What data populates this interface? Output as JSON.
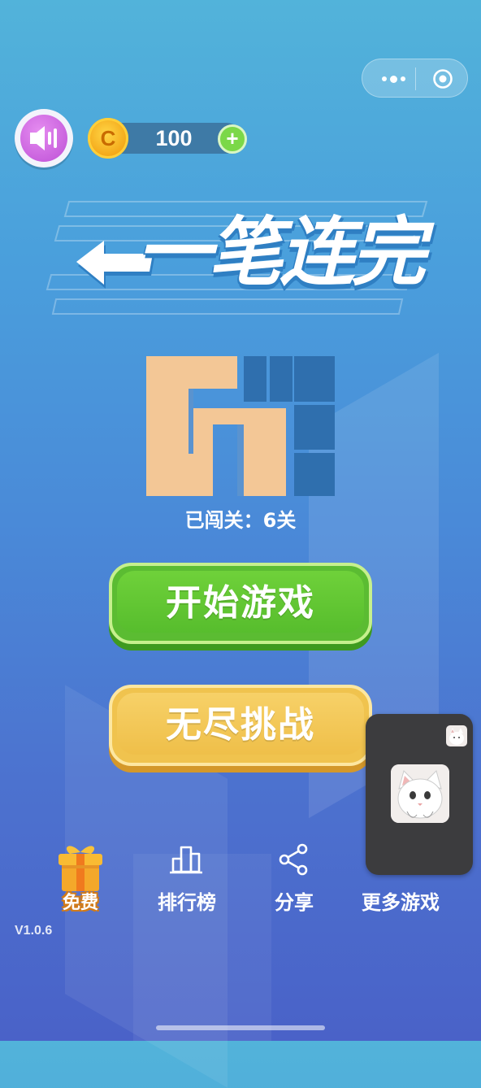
{
  "header": {
    "coins": "100",
    "coin_symbol": "C",
    "coin_plus": "+"
  },
  "logo": {
    "title": "一笔连完"
  },
  "preview": {
    "level_text": "已闯关：6关"
  },
  "buttons": {
    "start": "开始游戏",
    "endless": "无尽挑战"
  },
  "nav": {
    "free": "免费",
    "leaderboard": "排行榜",
    "share": "分享",
    "more_games": "更多游戏"
  },
  "version": "V1.0.6",
  "colors": {
    "start_button": "#5bbc32",
    "endless_button": "#f0c34e",
    "path_fill": "#f3c796",
    "grid_dark": "#2f6fae"
  }
}
